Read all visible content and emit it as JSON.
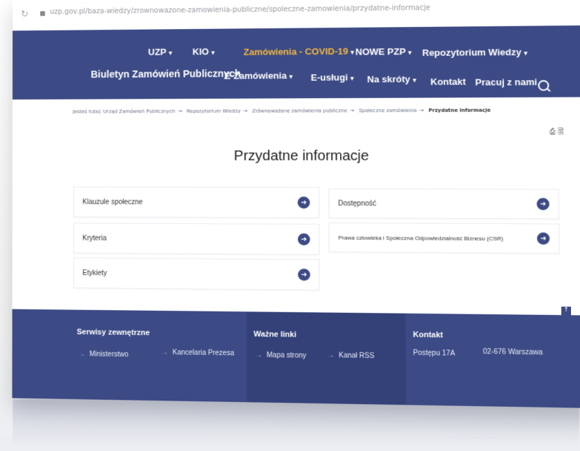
{
  "browser": {
    "url": "uzp.gov.pl/baza-wiedzy/zrownowazone-zamowienia-publiczne/spoleczne-zamowienia/przydatne-informacje"
  },
  "nav": {
    "row1": [
      "UZP",
      "KIO",
      "Zamówienia - COVID-19",
      "NOWE PZP",
      "Repozytorium Wiedzy"
    ],
    "row2_brand": "Biuletyn Zamówień Publicznych",
    "row2": [
      "E-Zamówienia",
      "E-usługi",
      "Na skróty",
      "Kontakt",
      "Pracuj z nami"
    ],
    "dropdown_marker": "▾",
    "accent_color": "#f2b73f",
    "nav_color": "#3c4a85"
  },
  "breadcrumb": {
    "prefix": "Jesteś tutaj:",
    "items": [
      "Urząd Zamówień Publicznych",
      "Repozytorium Wiedzy",
      "Zrównoważone zamówienia publiczne",
      "Społeczne zamówienia"
    ],
    "current": "Przydatne informacje",
    "separator": "→"
  },
  "page": {
    "title": "Przydatne informacje",
    "tools": [
      "print-icon",
      "pdf-icon"
    ]
  },
  "cards": {
    "left": [
      "Klauzule społeczne",
      "Kryteria",
      "Etykiety"
    ],
    "right": [
      "Dostępność",
      "Prawa człowieka i Społeczna Odpowiedzialność Biznesu (CSR)"
    ]
  },
  "footer": {
    "col1_title": "Serwisy zewnętrzne",
    "col1_links": [
      "Ministerstwo",
      "Kancelaria Prezesa"
    ],
    "col2_title": "Ważne linki",
    "col2_links": [
      "Mapa strony",
      "Kanał RSS"
    ],
    "col3_title": "Kontakt",
    "col3_address": "Postępu 17A",
    "col3_city": "02-676 Warszawa"
  }
}
